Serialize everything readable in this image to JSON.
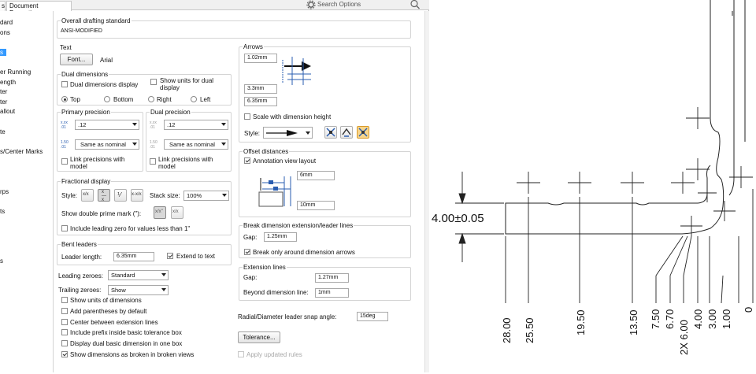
{
  "tabs": [
    {
      "label": "s"
    },
    {
      "label": "Document Properties"
    }
  ],
  "search": {
    "placeholder": "Search Options"
  },
  "tree": [
    "dard",
    "ons",
    "s",
    "er Running",
    "ength",
    "ter",
    "ter",
    "allout",
    "te",
    "s/Center Marks",
    "rps",
    "ts",
    "s"
  ],
  "drafting_standard": {
    "label": "Overall drafting standard",
    "value": "ANSI-MODIFIED"
  },
  "text": {
    "label": "Text",
    "font_button": "Font...",
    "font_name": "Arial"
  },
  "dual": {
    "group": "Dual dimensions",
    "display": "Dual dimensions display",
    "show_units": "Show units for dual display",
    "positions": [
      "Top",
      "Bottom",
      "Right",
      "Left"
    ],
    "selected": "Top"
  },
  "primary_precision": {
    "label": "Primary precision",
    "value": ".12",
    "tolerance": "Same as nominal",
    "link": "Link precisions with model"
  },
  "dual_precision": {
    "label": "Dual precision",
    "value": ".12",
    "tolerance": "Same as nominal",
    "link": "Link precisions with model"
  },
  "fractional": {
    "group": "Fractional display",
    "style_label": "Style:",
    "stack_label": "Stack size:",
    "stack_value": "100%",
    "double_prime": "Show double prime mark (\"):",
    "leading_zero": "Include leading zero for values less than 1\""
  },
  "bent_leaders": {
    "group": "Bent leaders",
    "length_label": "Leader length:",
    "length_value": "6.35mm",
    "extend": "Extend to text"
  },
  "leading_zeroes": {
    "label": "Leading zeroes:",
    "value": "Standard"
  },
  "trailing_zeroes": {
    "label": "Trailing zeroes:",
    "value": "Show"
  },
  "options": [
    {
      "label": "Show units of dimensions",
      "checked": false
    },
    {
      "label": "Add parentheses by default",
      "checked": false
    },
    {
      "label": "Center between extension lines",
      "checked": false
    },
    {
      "label": "Include prefix inside basic tolerance box",
      "checked": false
    },
    {
      "label": "Display dual basic dimension in one box",
      "checked": false
    },
    {
      "label": "Show dimensions as broken in broken views",
      "checked": true
    }
  ],
  "arrows": {
    "group": "Arrows",
    "v1": "1.02mm",
    "v2": "3.3mm",
    "v3": "6.35mm",
    "scale": "Scale with dimension height",
    "style_label": "Style:"
  },
  "offset": {
    "group": "Offset distances",
    "annotation_layout": "Annotation view layout",
    "v1": "6mm",
    "v2": "10mm"
  },
  "break": {
    "group": "Break dimension extension/leader lines",
    "gap_label": "Gap:",
    "gap_value": "1.25mm",
    "around_arrows": "Break only around dimension arrows"
  },
  "extension": {
    "group": "Extension lines",
    "gap_label": "Gap:",
    "gap_value": "1.27mm",
    "beyond_label": "Beyond dimension line:",
    "beyond_value": "1mm"
  },
  "radial": {
    "label": "Radial/Diameter leader snap angle:",
    "value": "15deg"
  },
  "tolerance_button": "Tolerance...",
  "apply_rules": "Apply updated rules",
  "drawing": {
    "height_dim": "4.00±0.05",
    "dims": [
      "28.00",
      "25.50",
      "19.50",
      "13.50",
      "7.50",
      "6.70",
      "2X 6.00",
      "4.00",
      "3.00",
      "1.00",
      "0"
    ]
  },
  "colors": {
    "selection": "#3399ff",
    "border": "#d4d4d4"
  }
}
